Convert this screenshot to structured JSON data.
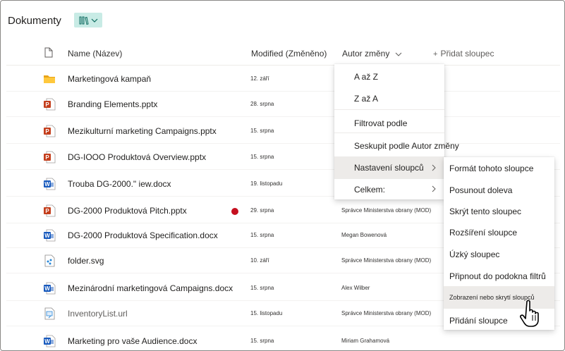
{
  "header": {
    "title": "Dokumenty"
  },
  "columns": {
    "name": "Name (Název)",
    "modified": "Modified (Změněno)",
    "author": "Autor změny",
    "add": "Přidat sloupec"
  },
  "rows": [
    {
      "name": "Marketingová kampaň",
      "modified": "12. září",
      "author": "",
      "icon": "folder-icon"
    },
    {
      "name": "Branding Elements.pptx",
      "modified": "28. srpna",
      "author": "",
      "icon": "powerpoint-icon"
    },
    {
      "name": "Mezikulturní marketing Campaigns.pptx",
      "modified": "15. srpna",
      "author": "",
      "icon": "powerpoint-icon"
    },
    {
      "name": "DG-IOOO Produktová Overview.pptx",
      "modified": "15. srpna",
      "author": "",
      "icon": "powerpoint-icon"
    },
    {
      "name": "Trouba DG-2000.\" iew.docx",
      "modified": "19. listopadu",
      "author": "",
      "icon": "word-icon"
    },
    {
      "name": "DG-2000 Produktová Pitch.pptx",
      "modified": "29. srpna",
      "author": "Správce Ministerstva obrany (MOD)",
      "icon": "powerpoint-icon"
    },
    {
      "name": "DG-2000 Produktová Specification.docx",
      "modified": "15. srpna",
      "author": "Megan Bowenová",
      "icon": "word-icon"
    },
    {
      "name": "folder.svg",
      "modified": "10. září",
      "author": "Správce Ministerstva obrany (MOD)",
      "icon": "svg-file-icon"
    },
    {
      "name": "Mezinárodní marketingová Campaigns.docx",
      "modified": "15. srpna",
      "author": "Alex Wilber",
      "icon": "word-icon"
    },
    {
      "name": "InventoryList.url",
      "modified": "15. listopadu",
      "author": "Správce Ministerstva obrany (MOD)",
      "icon": "url-file-icon"
    },
    {
      "name": "Marketing pro vaše Audience.docx",
      "modified": "15. srpna",
      "author": "Miriam Grahamová",
      "icon": "word-icon"
    }
  ],
  "column_menu": {
    "items": [
      "A až Z",
      "Z až A",
      "Filtrovat podle",
      "Seskupit podle Autor změny",
      "Nastavení sloupců",
      "Celkem:"
    ]
  },
  "settings_submenu": {
    "items": [
      "Formát tohoto sloupce",
      "Posunout doleva",
      "Skrýt tento sloupec",
      "Rozšíření sloupce",
      "Úzký sloupec",
      "Připnout do podokna filtrů",
      "Zobrazení nebo skrytí sloupců",
      "Přidání sloupce"
    ]
  },
  "colors": {
    "accent": "#c8ebe5",
    "word": "#185abd",
    "powerpoint": "#c43e1c",
    "folder": "#ffc83d"
  }
}
